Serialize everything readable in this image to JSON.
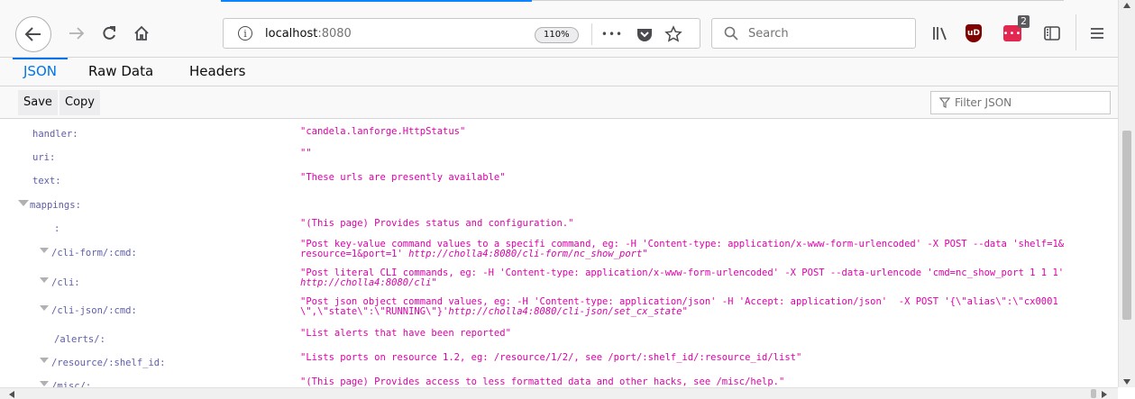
{
  "browser": {
    "url_host": "localhost",
    "url_port": ":8080",
    "zoom": "110%",
    "search_placeholder": "Search",
    "extension_badge": "2",
    "ublock_label": "uD",
    "page_actions_label": "•••",
    "icons": [
      "back-icon",
      "forward-icon",
      "reload-icon",
      "home-icon",
      "info-icon",
      "page-actions-icon",
      "pocket-icon",
      "bookmark-star-icon",
      "search-icon",
      "library-icon",
      "ublock-icon",
      "extension-icon",
      "sidebar-icon",
      "menu-icon"
    ]
  },
  "viewer": {
    "tabs": [
      {
        "label": "JSON",
        "active": true
      },
      {
        "label": "Raw Data",
        "active": false
      },
      {
        "label": "Headers",
        "active": false
      }
    ],
    "save_label": "Save",
    "copy_label": "Copy",
    "filter_placeholder": "Filter JSON"
  },
  "json": {
    "rows": [
      {
        "key": "handler:",
        "value": "\"candela.lanforge.HttpStatus\""
      },
      {
        "key": "uri:",
        "value": "\"\""
      },
      {
        "key": "text:",
        "value": "\"These urls are presently available\""
      },
      {
        "key": "mappings:",
        "value": ""
      },
      {
        "key": ":",
        "value": "\"(This page) Provides status and configuration.\""
      },
      {
        "key": "/cli-form/:cmd:",
        "value": "\"Post key-value command values to a specifi command, eg: -H 'Content-type: application/x-www-form-urlencoded' -X POST --data 'shelf=1&",
        "value2": "resource=1&port=1' ",
        "link": "http://cholla4:8080/cli-form/nc_show_port",
        "end": "\""
      },
      {
        "key": "/cli:",
        "value": "\"Post literal CLI commands, eg: -H 'Content-type: application/x-www-form-urlencoded' -X POST --data-urlencode 'cmd=nc_show_port 1 1 1'",
        "value2": "",
        "link": "http://cholla4:8080/cli",
        "end": "\""
      },
      {
        "key": "/cli-json/:cmd:",
        "value": "\"Post json object command values, eg: -H 'Content-type: application/json' -H 'Accept: application/json'  -X POST '{\\\"alias\\\":\\\"cx0001",
        "value2": "\\\",\\\"state\\\":\\\"RUNNING\\\"}'",
        "link": "http://cholla4:8080/cli-json/set_cx_state",
        "end": "\""
      },
      {
        "key": "/alerts/:",
        "value": "\"List alerts that have been reported\""
      },
      {
        "key": "/resource/:shelf_id:",
        "value": "\"Lists ports on resource 1.2, eg: /resource/1/2/, see /port/:shelf_id/:resource_id/list\""
      },
      {
        "key": "/misc/:",
        "value": "\"(This page) Provides access to less formatted data and other hacks, see /misc/help.\""
      }
    ]
  }
}
